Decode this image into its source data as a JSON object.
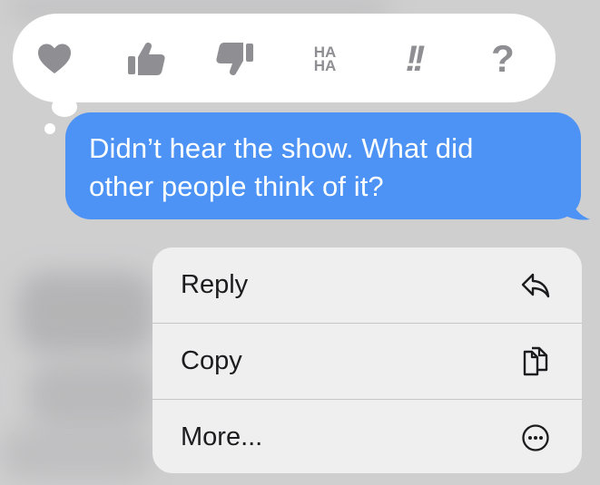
{
  "tapback": {
    "reactions": [
      {
        "name": "heart-icon",
        "label": ""
      },
      {
        "name": "thumbs-up-icon",
        "label": ""
      },
      {
        "name": "thumbs-down-icon",
        "label": ""
      },
      {
        "name": "haha-icon",
        "label_top": "HA",
        "label_bottom": "HA"
      },
      {
        "name": "exclamation-icon",
        "label": "!!"
      },
      {
        "name": "question-icon",
        "label": "?"
      }
    ]
  },
  "message": {
    "line1": "Didn’t hear the show. What did",
    "line2": "other people think of it?",
    "bubble_color": "#4c93f5"
  },
  "menu": {
    "items": [
      {
        "label": "Reply",
        "icon": "reply-arrow-icon"
      },
      {
        "label": "Copy",
        "icon": "copy-icon"
      },
      {
        "label": "More...",
        "icon": "more-ellipsis-icon"
      }
    ]
  }
}
